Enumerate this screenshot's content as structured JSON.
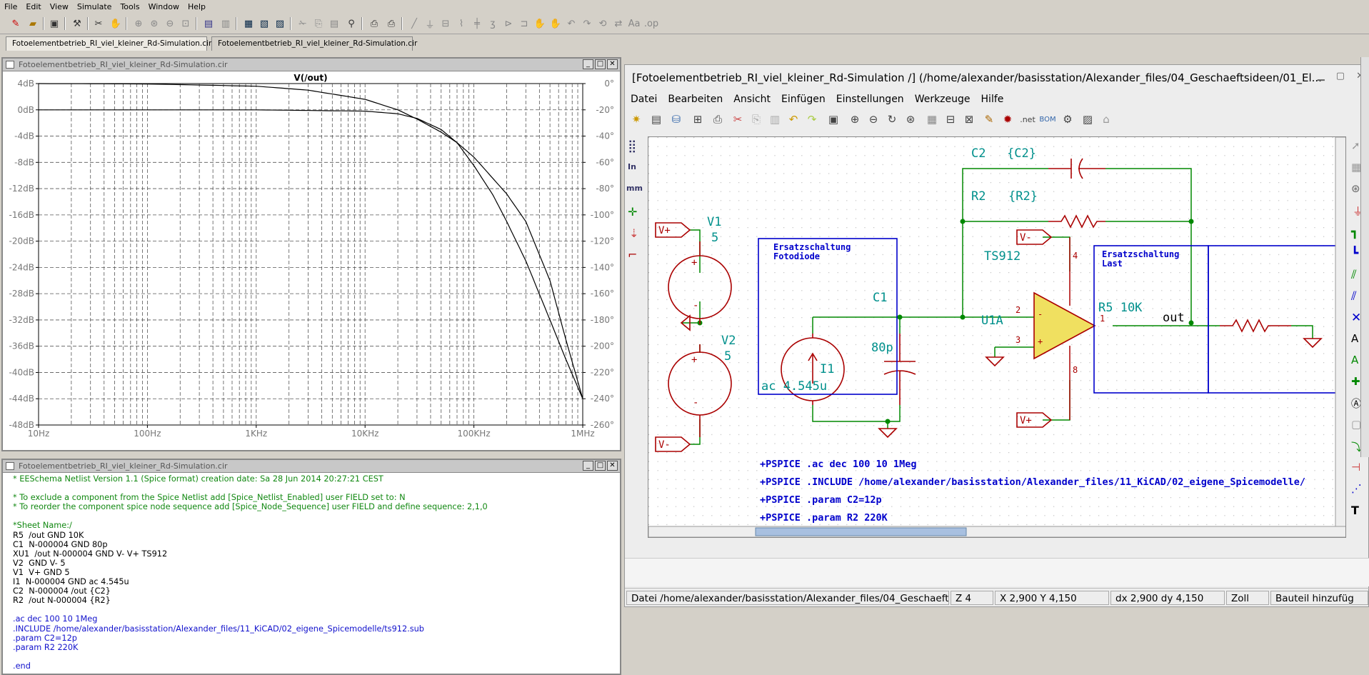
{
  "ltspice": {
    "menu": [
      "File",
      "Edit",
      "View",
      "Simulate",
      "Tools",
      "Window",
      "Help"
    ],
    "tabs": [
      "Fotoelementbetrieb_RI_viel_kleiner_Rd-Simulation.cir",
      "Fotoelementbetrieb_RI_viel_kleiner_Rd-Simulation.cir"
    ],
    "plot_window_title": "Fotoelementbetrieb_RI_viel_kleiner_Rd-Simulation.cir",
    "netlist_window_title": "Fotoelementbetrieb_RI_viel_kleiner_Rd-Simulation.cir",
    "netlist_lines": [
      {
        "text": "* EESchema Netlist Version 1.1 (Spice format) creation date: Sa 28 Jun 2014 20:27:21 CEST",
        "color": "green"
      },
      {
        "text": "",
        "color": "black"
      },
      {
        "text": "* To exclude a component from the Spice Netlist add [Spice_Netlist_Enabled] user FIELD set to: N",
        "color": "green"
      },
      {
        "text": "* To reorder the component spice node sequence add [Spice_Node_Sequence] user FIELD and define sequence: 2,1,0",
        "color": "green"
      },
      {
        "text": "",
        "color": "black"
      },
      {
        "text": "*Sheet Name:/",
        "color": "green"
      },
      {
        "text": "R5  /out GND 10K",
        "color": "black"
      },
      {
        "text": "C1  N-000004 GND 80p",
        "color": "black"
      },
      {
        "text": "XU1  /out N-000004 GND V- V+ TS912",
        "color": "black"
      },
      {
        "text": "V2  GND V- 5",
        "color": "black"
      },
      {
        "text": "V1  V+ GND 5",
        "color": "black"
      },
      {
        "text": "I1  N-000004 GND ac 4.545u",
        "color": "black"
      },
      {
        "text": "C2  N-000004 /out {C2}",
        "color": "black"
      },
      {
        "text": "R2  /out N-000004 {R2}",
        "color": "black"
      },
      {
        "text": "",
        "color": "black"
      },
      {
        "text": ".ac dec 100 10 1Meg",
        "color": "blue"
      },
      {
        "text": ".INCLUDE /home/alexander/basisstation/Alexander_files/11_KiCAD/02_eigene_Spicemodelle/ts912.sub",
        "color": "blue"
      },
      {
        "text": ".param C2=12p",
        "color": "blue"
      },
      {
        "text": ".param R2 220K",
        "color": "blue"
      },
      {
        "text": "",
        "color": "black"
      },
      {
        "text": ".end",
        "color": "blue"
      }
    ]
  },
  "chart_data": {
    "type": "line",
    "title": "V(/out)",
    "xscale": "log",
    "xlim": [
      10,
      1000000
    ],
    "x_tick_labels": [
      "10Hz",
      "100Hz",
      "1KHz",
      "10KHz",
      "100KHz",
      "1MHz"
    ],
    "y_left_lim": [
      -48,
      4
    ],
    "y_left_tick_labels": [
      "4dB",
      "0dB",
      "-4dB",
      "-8dB",
      "-12dB",
      "-16dB",
      "-20dB",
      "-24dB",
      "-28dB",
      "-32dB",
      "-36dB",
      "-40dB",
      "-44dB",
      "-48dB"
    ],
    "y_right_lim": [
      -260,
      0
    ],
    "y_right_tick_labels": [
      "0°",
      "-20°",
      "-40°",
      "-60°",
      "-80°",
      "-100°",
      "-120°",
      "-140°",
      "-160°",
      "-180°",
      "-200°",
      "-220°",
      "-240°",
      "-260°"
    ],
    "grid": true,
    "series": [
      {
        "axis": "left",
        "x": [
          10,
          1000,
          10000,
          20000,
          30000,
          50000,
          70000,
          100000,
          150000,
          200000,
          300000,
          500000,
          700000,
          1000000
        ],
        "values": [
          0,
          0,
          -0.2,
          -0.6,
          -1.3,
          -3,
          -5,
          -8.5,
          -13,
          -17,
          -23,
          -32,
          -38,
          -44
        ]
      },
      {
        "axis": "right",
        "x": [
          10,
          100,
          1000,
          3000,
          10000,
          20000,
          30000,
          50000,
          70000,
          100000,
          200000,
          300000,
          500000,
          700000,
          1000000
        ],
        "values": [
          0,
          -0.3,
          -2,
          -5,
          -12,
          -20,
          -27,
          -37,
          -45,
          -56,
          -84,
          -105,
          -150,
          -195,
          -240
        ]
      }
    ]
  },
  "kicad": {
    "title": "[Fotoelementbetrieb_RI_viel_kleiner_Rd-Simulation /] (/home/alexander/basisstation/Alexander_files/04_Geschaeftsideen/01_El...",
    "menu": [
      "Datei",
      "Bearbeiten",
      "Ansicht",
      "Einfügen",
      "Einstellungen",
      "Werkzeuge",
      "Hilfe"
    ],
    "left_tools": {
      "inch": "In",
      "mm": "mm"
    },
    "status": {
      "file": "Datei /home/alexander/basisstation/Alexander_files/04_Geschaefts",
      "zoom": "Z 4",
      "xy": "X 2,900  Y 4,150",
      "dxdy": "dx 2,900  dy 4,150",
      "unit": "Zoll",
      "mode": "Bauteil hinzufüg"
    },
    "schematic": {
      "c2_ref": "C2",
      "c2_val": "{C2}",
      "r2_ref": "R2",
      "r2_val": "{R2}",
      "v1_ref": "V1",
      "v1_val": "5",
      "v2_ref": "V2",
      "v2_val": "5",
      "vplus": "V+",
      "vminus": "V-",
      "box1_title": "Ersatzschaltung",
      "box1_sub": "Fotodiode",
      "i1_ref": "I1",
      "i1_val": "ac 4.545u",
      "c1_ref": "C1",
      "c1_val": "80p",
      "u1_name": "TS912",
      "u1_ref": "U1A",
      "pin2": "2",
      "pin3": "3",
      "pin1": "1",
      "pin4": "4",
      "pin8": "8",
      "pin_minus": "-",
      "pin_plus": "+",
      "net_out": "out",
      "box2_title": "Ersatzschaltung",
      "box2_sub": "Last",
      "r5": "R5  10K",
      "spice_lines": [
        "+PSPICE .ac dec 100 10 1Meg",
        "+PSPICE .INCLUDE /home/alexander/basisstation/Alexander_files/11_KiCAD/02_eigene_Spicemodelle/",
        "+PSPICE .param C2=12p",
        "+PSPICE .param R2 220K"
      ]
    }
  },
  "colors": {
    "bg": "#d4d0c8",
    "wire": "#008800",
    "symbol": "#aa0000",
    "text_cyan": "#00908c",
    "box": "#0000cc",
    "netlist_green": "#118811",
    "netlist_blue": "#1111cc"
  }
}
